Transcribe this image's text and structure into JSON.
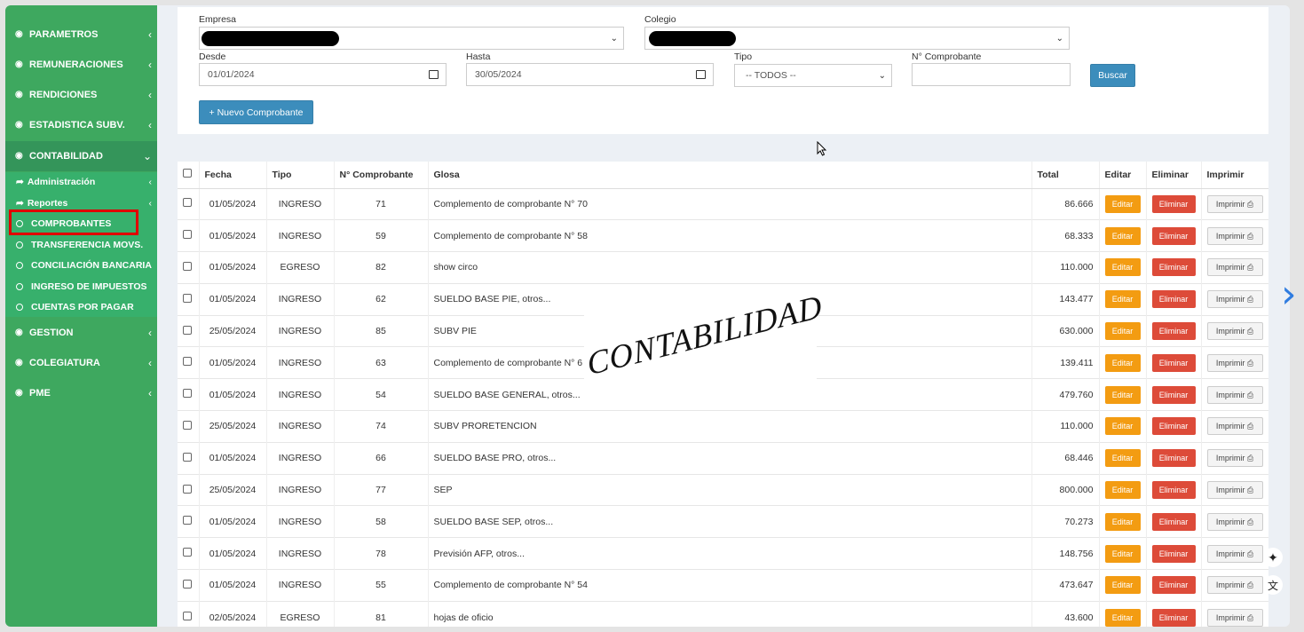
{
  "sidebar": {
    "items": [
      {
        "label": "PARAMETROS"
      },
      {
        "label": "REMUNERACIONES"
      },
      {
        "label": "RENDICIONES"
      },
      {
        "label": "ESTADISTICA SUBV."
      },
      {
        "label": "CONTABILIDAD"
      },
      {
        "label": "GESTION"
      },
      {
        "label": "COLEGIATURA"
      },
      {
        "label": "PME"
      }
    ],
    "sub": [
      {
        "label": "Administración"
      },
      {
        "label": "Reportes"
      }
    ],
    "leaves": [
      {
        "label": "COMPROBANTES"
      },
      {
        "label": "TRANSFERENCIA MOVS."
      },
      {
        "label": "CONCILIACIÓN BANCARIA"
      },
      {
        "label": "INGRESO DE IMPUESTOS"
      },
      {
        "label": "CUENTAS POR PAGAR"
      }
    ]
  },
  "filters": {
    "empresa_label": "Empresa",
    "colegio_label": "Colegio",
    "desde_label": "Desde",
    "desde_value": "01/01/2024",
    "hasta_label": "Hasta",
    "hasta_value": "30/05/2024",
    "tipo_label": "Tipo",
    "tipo_value": "-- TODOS --",
    "comprobante_label": "N° Comprobante",
    "buscar_label": "Buscar",
    "nuevo_label": "+ Nuevo Comprobante"
  },
  "table": {
    "headers": [
      "Fecha",
      "Tipo",
      "N° Comprobante",
      "Glosa",
      "Total",
      "Editar",
      "Eliminar",
      "Imprimir"
    ],
    "edit_label": "Editar",
    "delete_label": "Eliminar",
    "print_label": "Imprimir",
    "rows": [
      {
        "fecha": "01/05/2024",
        "tipo": "INGRESO",
        "num": "71",
        "glosa": "Complemento de comprobante N° 70",
        "total": "86.666"
      },
      {
        "fecha": "01/05/2024",
        "tipo": "INGRESO",
        "num": "59",
        "glosa": "Complemento de comprobante N° 58",
        "total": "68.333"
      },
      {
        "fecha": "01/05/2024",
        "tipo": "EGRESO",
        "num": "82",
        "glosa": "show circo",
        "total": "110.000"
      },
      {
        "fecha": "01/05/2024",
        "tipo": "INGRESO",
        "num": "62",
        "glosa": "SUELDO BASE PIE, otros...",
        "total": "143.477"
      },
      {
        "fecha": "25/05/2024",
        "tipo": "INGRESO",
        "num": "85",
        "glosa": "SUBV PIE",
        "total": "630.000"
      },
      {
        "fecha": "01/05/2024",
        "tipo": "INGRESO",
        "num": "63",
        "glosa": "Complemento de comprobante N° 6",
        "total": "139.411"
      },
      {
        "fecha": "01/05/2024",
        "tipo": "INGRESO",
        "num": "54",
        "glosa": "SUELDO BASE GENERAL, otros...",
        "total": "479.760"
      },
      {
        "fecha": "25/05/2024",
        "tipo": "INGRESO",
        "num": "74",
        "glosa": "SUBV PRORETENCION",
        "total": "110.000"
      },
      {
        "fecha": "01/05/2024",
        "tipo": "INGRESO",
        "num": "66",
        "glosa": "SUELDO BASE PRO, otros...",
        "total": "68.446"
      },
      {
        "fecha": "25/05/2024",
        "tipo": "INGRESO",
        "num": "77",
        "glosa": "SEP",
        "total": "800.000"
      },
      {
        "fecha": "01/05/2024",
        "tipo": "INGRESO",
        "num": "58",
        "glosa": "SUELDO BASE SEP, otros...",
        "total": "70.273"
      },
      {
        "fecha": "01/05/2024",
        "tipo": "INGRESO",
        "num": "78",
        "glosa": "Previsión AFP, otros...",
        "total": "148.756"
      },
      {
        "fecha": "01/05/2024",
        "tipo": "INGRESO",
        "num": "55",
        "glosa": "Complemento de comprobante N° 54",
        "total": "473.647"
      },
      {
        "fecha": "02/05/2024",
        "tipo": "EGRESO",
        "num": "81",
        "glosa": "hojas de oficio",
        "total": "43.600"
      }
    ]
  },
  "overlay": {
    "watermark": "CONTABILIDAD"
  },
  "colors": {
    "sidebar": "#3ea85f",
    "sub": "#37b06c",
    "edit": "#f39c12",
    "delete": "#dd4b39",
    "primary": "#3c8dbc"
  }
}
